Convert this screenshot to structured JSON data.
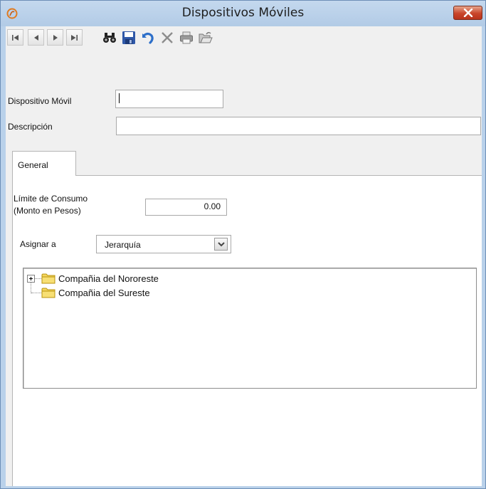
{
  "window": {
    "title": "Dispositivos Móviles"
  },
  "toolbar": {
    "buttons": [
      {
        "name": "first-record",
        "icon": "first-record-icon"
      },
      {
        "name": "previous-record",
        "icon": "previous-record-icon"
      },
      {
        "name": "next-record",
        "icon": "next-record-icon"
      },
      {
        "name": "last-record",
        "icon": "last-record-icon"
      },
      {
        "name": "find",
        "icon": "binoculars-icon"
      },
      {
        "name": "save",
        "icon": "save-icon"
      },
      {
        "name": "undo",
        "icon": "undo-icon"
      },
      {
        "name": "delete",
        "icon": "delete-icon"
      },
      {
        "name": "print",
        "icon": "printer-icon"
      },
      {
        "name": "open",
        "icon": "open-folder-icon"
      }
    ]
  },
  "form": {
    "device_label": "Dispositivo Móvil",
    "device_value": "",
    "description_label": "Descripción",
    "description_value": ""
  },
  "tabs": [
    {
      "label": "General",
      "active": true
    }
  ],
  "general": {
    "limit_label_line1": "Límite de Consumo",
    "limit_label_line2": "(Monto en Pesos)",
    "limit_value": "0.00",
    "assign_label": "Asignar a",
    "assign_selected": "Jerarquía"
  },
  "tree": {
    "nodes": [
      {
        "label": "Compañia del Nororeste",
        "expandable": true,
        "icon": "folder-icon"
      },
      {
        "label": "Compañia del Sureste",
        "expandable": false,
        "icon": "folder-icon"
      }
    ]
  },
  "colors": {
    "titlebar": "#b9d1ea",
    "client_background": "#f0f0f0",
    "close_button": "#c9452a",
    "folder": "#f5d65e"
  }
}
